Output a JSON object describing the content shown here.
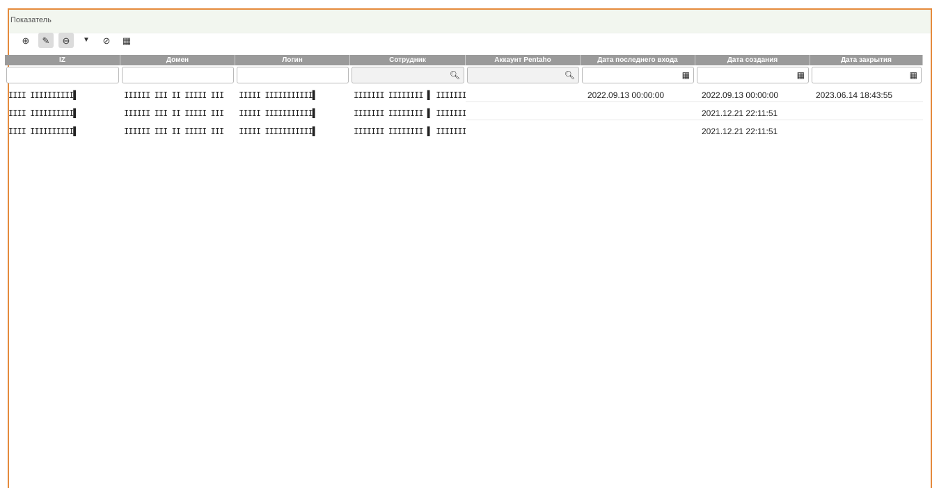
{
  "panel": {
    "title": "Показатель"
  },
  "toolbar": {
    "buttons": [
      {
        "name": "add-button",
        "icon": "plus-circle-icon",
        "glyph": "⊕"
      },
      {
        "name": "edit-button",
        "icon": "edit-icon",
        "glyph": "✎"
      },
      {
        "name": "remove-button",
        "icon": "minus-circle-icon",
        "glyph": "⊖"
      },
      {
        "name": "filter-button",
        "icon": "filter-icon",
        "glyph": "▼"
      },
      {
        "name": "cancel-filter-button",
        "icon": "ban-icon",
        "glyph": "⊘"
      },
      {
        "name": "columns-button",
        "icon": "table-icon",
        "glyph": "▦"
      }
    ]
  },
  "grid": {
    "columns": [
      "IZ",
      "Домен",
      "Логин",
      "Сотрудник",
      "Аккаунт Pentaho",
      "Дата последнего входа",
      "Дата создания",
      "Дата закрытия"
    ],
    "filter_icons": [
      "",
      "",
      "",
      "search-icon",
      "search-icon",
      "calendar-icon",
      "calendar-icon",
      "calendar-icon"
    ],
    "rows": [
      {
        "iz": "IIII IIIIIIIIII▌",
        "domain": "IIIIII III II IIIII III",
        "login": "IIIII IIIIIIIIIII▌",
        "employee": "IIIIIII IIIIIIII ▌ IIIIIIIIIIIII IIIII",
        "pentaho": "",
        "last_login": "2022.09.13 00:00:00",
        "created": "2022.09.13 00:00:00",
        "closed": "2023.06.14 18:43:55"
      },
      {
        "iz": "IIII IIIIIIIIII▌",
        "domain": "IIIIII III II IIIII III",
        "login": "IIIII IIIIIIIIIII▌",
        "employee": "IIIIIII IIIIIIII ▌ IIIIIIIIIIIII IIIII",
        "pentaho": "",
        "last_login": "",
        "created": "2021.12.21 22:11:51",
        "closed": ""
      },
      {
        "iz": "IIII IIIIIIIIII▌",
        "domain": "IIIIII III II IIIII III",
        "login": "IIIII IIIIIIIIIII▌",
        "employee": "IIIIIII IIIIIIII ▌ IIIIIIIIIIIII IIIII",
        "pentaho": "",
        "last_login": "",
        "created": "2021.12.21 22:11:51",
        "closed": ""
      }
    ]
  },
  "colors": {
    "border": "#e58a3c",
    "header_bg": "#9a9a9a",
    "title_bg": "#f2f6ef"
  }
}
